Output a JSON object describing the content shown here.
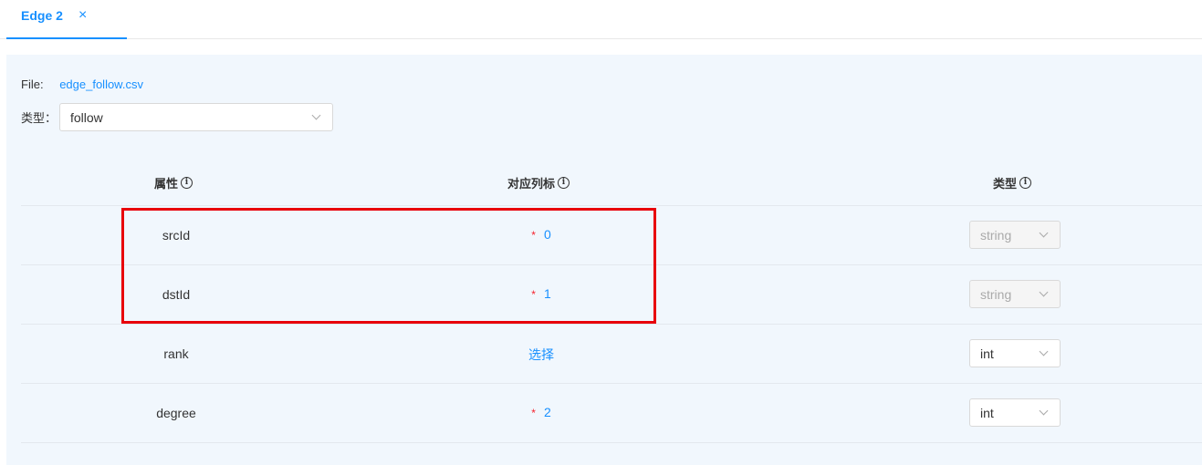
{
  "tab": {
    "label": "Edge 2",
    "close": "×"
  },
  "file": {
    "label": "File:",
    "name": "edge_follow.csv"
  },
  "type": {
    "label": "类型：",
    "value": "follow"
  },
  "table": {
    "headers": {
      "attr": "属性",
      "column": "对应列标",
      "type": "类型",
      "info": "i"
    },
    "rows": [
      {
        "name": "srcId",
        "required": true,
        "column": "0",
        "type": "string",
        "disabled": true
      },
      {
        "name": "dstId",
        "required": true,
        "column": "1",
        "type": "string",
        "disabled": true
      },
      {
        "name": "rank",
        "required": false,
        "column": "选择",
        "type": "int",
        "disabled": false
      },
      {
        "name": "degree",
        "required": true,
        "column": "2",
        "type": "int",
        "disabled": false
      }
    ],
    "required_mark": "*"
  },
  "colors": {
    "accent": "#1890ff",
    "required": "#f5222d",
    "highlight": "#e8000b",
    "panel": "#f1f7fd"
  }
}
